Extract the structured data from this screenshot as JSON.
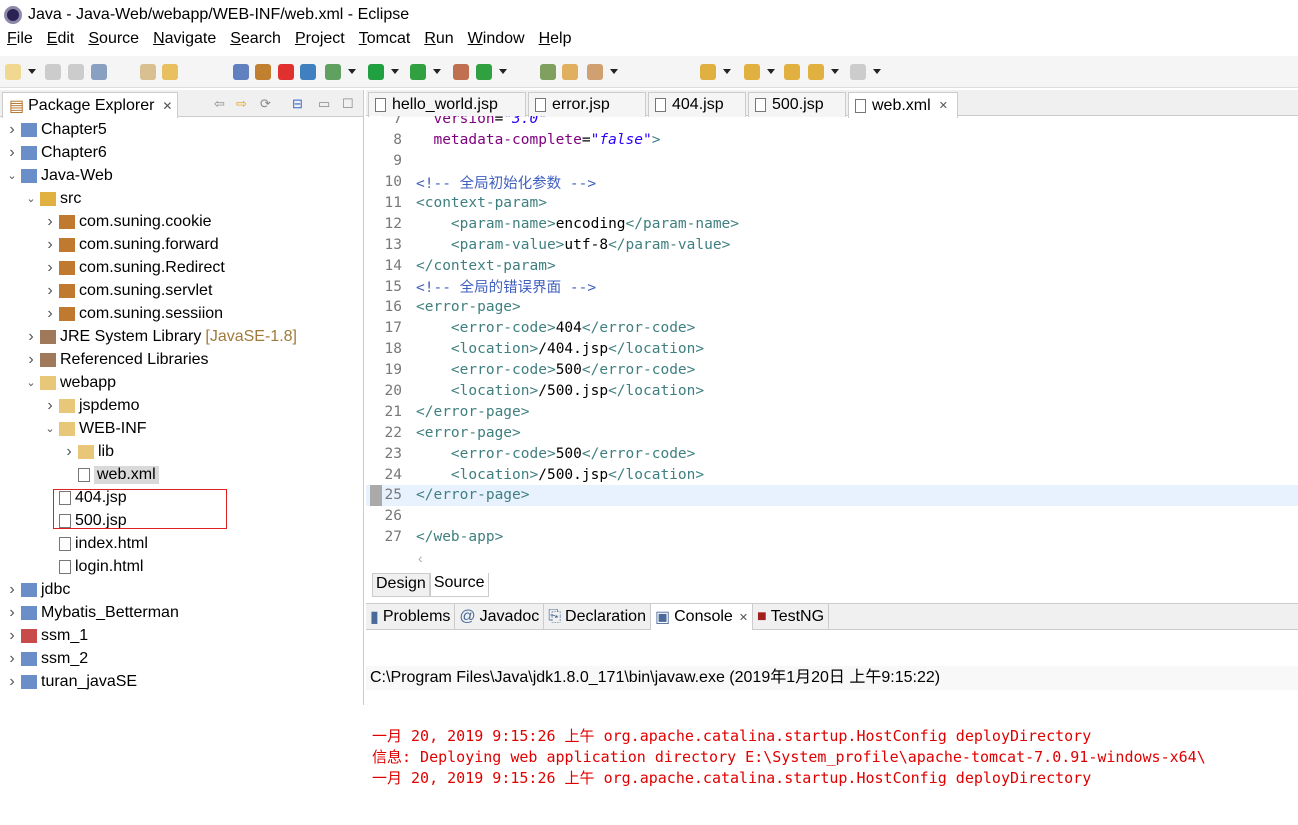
{
  "window": {
    "title": "Java - Java-Web/webapp/WEB-INF/web.xml - Eclipse"
  },
  "menu": [
    "File",
    "Edit",
    "Source",
    "Navigate",
    "Search",
    "Project",
    "Tomcat",
    "Run",
    "Window",
    "Help"
  ],
  "explorer": {
    "title": "Package Explorer",
    "items": [
      {
        "label": "Chapter5",
        "level": 0,
        "state": "collapsed",
        "icon": "project-icon"
      },
      {
        "label": "Chapter6",
        "level": 0,
        "state": "collapsed",
        "icon": "project-icon"
      },
      {
        "label": "Java-Web",
        "level": 0,
        "state": "expanded",
        "icon": "java-project-icon"
      },
      {
        "label": "src",
        "level": 1,
        "state": "expanded",
        "icon": "source-folder-icon"
      },
      {
        "label": "com.suning.cookie",
        "level": 2,
        "state": "collapsed",
        "icon": "package-icon"
      },
      {
        "label": "com.suning.forward",
        "level": 2,
        "state": "collapsed",
        "icon": "package-icon"
      },
      {
        "label": "com.suning.Redirect",
        "level": 2,
        "state": "collapsed",
        "icon": "package-icon"
      },
      {
        "label": "com.suning.servlet",
        "level": 2,
        "state": "collapsed",
        "icon": "package-icon"
      },
      {
        "label": "com.suning.sessiion",
        "level": 2,
        "state": "collapsed",
        "icon": "package-icon"
      },
      {
        "label": "JRE System Library",
        "decoration": "[JavaSE-1.8]",
        "level": 1,
        "state": "collapsed",
        "icon": "library-icon"
      },
      {
        "label": "Referenced Libraries",
        "level": 1,
        "state": "collapsed",
        "icon": "library-icon"
      },
      {
        "label": "webapp",
        "level": 1,
        "state": "expanded",
        "icon": "folder-open-icon"
      },
      {
        "label": "jspdemo",
        "level": 2,
        "state": "collapsed",
        "icon": "folder-icon"
      },
      {
        "label": "WEB-INF",
        "level": 2,
        "state": "expanded",
        "icon": "folder-open-icon"
      },
      {
        "label": "lib",
        "level": 3,
        "state": "collapsed",
        "icon": "folder-icon"
      },
      {
        "label": "web.xml",
        "level": 3,
        "state": "leaf",
        "icon": "xml-file-icon",
        "selected": true
      },
      {
        "label": "404.jsp",
        "level": 2,
        "state": "leaf",
        "icon": "file-icon"
      },
      {
        "label": "500.jsp",
        "level": 2,
        "state": "leaf",
        "icon": "file-icon"
      },
      {
        "label": "index.html",
        "level": 2,
        "state": "leaf",
        "icon": "file-icon"
      },
      {
        "label": "login.html",
        "level": 2,
        "state": "leaf",
        "icon": "file-icon"
      },
      {
        "label": "jdbc",
        "level": 0,
        "state": "collapsed",
        "icon": "java-project-icon"
      },
      {
        "label": "Mybatis_Betterman",
        "level": 0,
        "state": "collapsed",
        "icon": "java-project-icon"
      },
      {
        "label": "ssm_1",
        "level": 0,
        "state": "collapsed",
        "icon": "java-project-error-icon"
      },
      {
        "label": "ssm_2",
        "level": 0,
        "state": "collapsed",
        "icon": "java-project-icon"
      },
      {
        "label": "turan_javaSE",
        "level": 0,
        "state": "collapsed",
        "icon": "java-project-icon"
      }
    ]
  },
  "editor": {
    "tabs": [
      {
        "label": "hello_world.jsp"
      },
      {
        "label": "error.jsp"
      },
      {
        "label": "404.jsp"
      },
      {
        "label": "500.jsp"
      },
      {
        "label": "web.xml",
        "active": true
      }
    ],
    "current_line": 25,
    "lines": [
      {
        "n": "7",
        "t": [
          [
            "plain",
            "  "
          ],
          [
            "attr",
            "version"
          ],
          [
            "plain",
            "="
          ],
          [
            "val",
            "\"3.0\""
          ]
        ]
      },
      {
        "n": "8",
        "t": [
          [
            "plain",
            "  "
          ],
          [
            "attr",
            "metadata-complete"
          ],
          [
            "plain",
            "="
          ],
          [
            "val",
            "\"false\""
          ],
          [
            "tag",
            ">"
          ]
        ]
      },
      {
        "n": "9",
        "t": []
      },
      {
        "n": "10",
        "t": [
          [
            "cmt",
            "<!-- 全局初始化参数 -->"
          ]
        ]
      },
      {
        "n": "11",
        "fold": true,
        "t": [
          [
            "tag",
            "<context-param>"
          ]
        ]
      },
      {
        "n": "12",
        "t": [
          [
            "plain",
            "    "
          ],
          [
            "tag",
            "<param-name>"
          ],
          [
            "plain",
            "encoding"
          ],
          [
            "tag",
            "</param-name>"
          ]
        ]
      },
      {
        "n": "13",
        "t": [
          [
            "plain",
            "    "
          ],
          [
            "tag",
            "<param-value>"
          ],
          [
            "plain",
            "utf-8"
          ],
          [
            "tag",
            "</param-value>"
          ]
        ]
      },
      {
        "n": "14",
        "t": [
          [
            "tag",
            "</context-param>"
          ]
        ]
      },
      {
        "n": "15",
        "t": [
          [
            "cmt",
            "<!-- 全局的错误界面 -->"
          ]
        ]
      },
      {
        "n": "16",
        "fold": true,
        "t": [
          [
            "tag",
            "<error-page>"
          ]
        ]
      },
      {
        "n": "17",
        "t": [
          [
            "plain",
            "    "
          ],
          [
            "tag",
            "<error-code>"
          ],
          [
            "plain",
            "404"
          ],
          [
            "tag",
            "</error-code>"
          ]
        ]
      },
      {
        "n": "18",
        "t": [
          [
            "plain",
            "    "
          ],
          [
            "tag",
            "<location>"
          ],
          [
            "plain",
            "/404.jsp"
          ],
          [
            "tag",
            "</location>"
          ]
        ]
      },
      {
        "n": "19",
        "t": [
          [
            "plain",
            "    "
          ],
          [
            "tag",
            "<error-code>"
          ],
          [
            "plain",
            "500"
          ],
          [
            "tag",
            "</error-code>"
          ]
        ]
      },
      {
        "n": "20",
        "t": [
          [
            "plain",
            "    "
          ],
          [
            "tag",
            "<location>"
          ],
          [
            "plain",
            "/500.jsp"
          ],
          [
            "tag",
            "</location>"
          ]
        ]
      },
      {
        "n": "21",
        "t": [
          [
            "tag",
            "</error-page>"
          ]
        ]
      },
      {
        "n": "22",
        "fold": true,
        "t": [
          [
            "tag",
            "<error-page>"
          ]
        ]
      },
      {
        "n": "23",
        "t": [
          [
            "plain",
            "    "
          ],
          [
            "tag",
            "<error-code>"
          ],
          [
            "plain",
            "500"
          ],
          [
            "tag",
            "</error-code>"
          ]
        ]
      },
      {
        "n": "24",
        "t": [
          [
            "plain",
            "    "
          ],
          [
            "tag",
            "<location>"
          ],
          [
            "plain",
            "/500.jsp"
          ],
          [
            "tag",
            "</location>"
          ]
        ]
      },
      {
        "n": "25",
        "t": [
          [
            "tag",
            "</error-page>"
          ]
        ]
      },
      {
        "n": "26",
        "t": []
      },
      {
        "n": "27",
        "t": [
          [
            "tag",
            "</web-app>"
          ]
        ]
      }
    ],
    "mode_tabs": {
      "design": "Design",
      "source": "Source",
      "active": "Source"
    }
  },
  "bottom": {
    "tabs": [
      {
        "label": "Problems",
        "icon": "problems-icon"
      },
      {
        "label": "Javadoc",
        "icon": "at-icon"
      },
      {
        "label": "Declaration",
        "icon": "declaration-icon"
      },
      {
        "label": "Console",
        "icon": "console-icon",
        "active": true
      },
      {
        "label": "TestNG",
        "icon": "testng-icon"
      }
    ],
    "console_title": "C:\\Program Files\\Java\\jdk1.8.0_171\\bin\\javaw.exe (2019年1月20日 上午9:15:22)",
    "lines": [
      "一月 20, 2019 9:15:26 上午 org.apache.catalina.startup.HostConfig deployDirectory",
      "信息: Deploying web application directory E:\\System_profile\\apache-tomcat-7.0.91-windows-x64\\",
      "一月 20, 2019 9:15:26 上午 org.apache.catalina.startup.HostConfig deployDirectory"
    ]
  }
}
